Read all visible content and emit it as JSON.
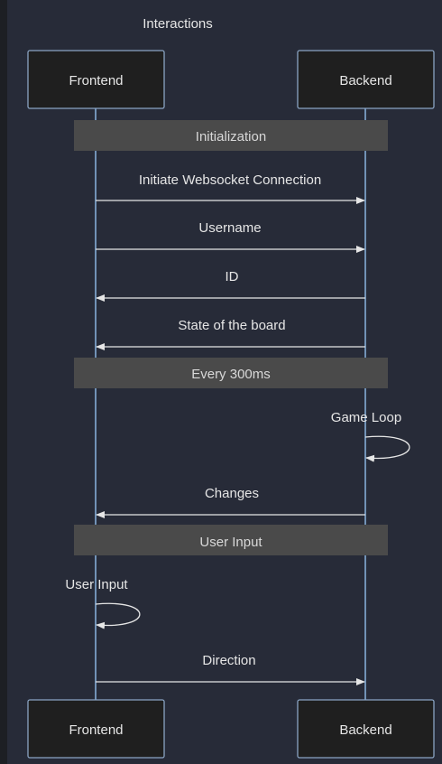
{
  "title": "Interactions",
  "participants": {
    "frontend": "Frontend",
    "backend": "Backend"
  },
  "sections": {
    "initialization": "Initialization",
    "every_300ms": "Every 300ms",
    "user_input": "User Input"
  },
  "messages": {
    "initiate_ws": "Initiate Websocket Connection",
    "username": "Username",
    "id": "ID",
    "board_state": "State of the board",
    "game_loop": "Game Loop",
    "changes": "Changes",
    "user_input_self": "User Input",
    "direction": "Direction"
  },
  "colors": {
    "page_background": "#1d1f24",
    "panel_background": "#272b38",
    "box_fill": "#1f1f1f",
    "box_stroke": "#8aa4c4",
    "lifeline": "#8ab4e0",
    "section_fill": "#4a4a4a",
    "text": "#e6e6e6",
    "arrow": "#e6e6e6"
  }
}
